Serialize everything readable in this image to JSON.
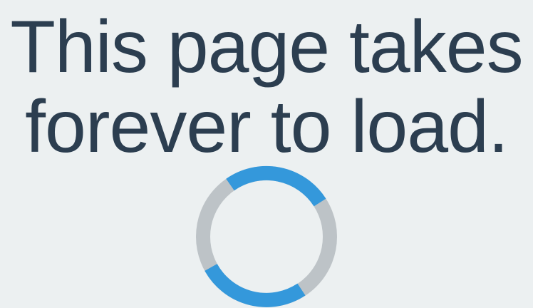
{
  "message": {
    "line1": "This page takes",
    "line2": "forever to load."
  },
  "spinner": {
    "track_color": "#bdc3c7",
    "accent_color": "#3498db",
    "icon": "loading-spinner-icon"
  },
  "colors": {
    "background": "#ecf0f1",
    "text": "#2c3e50"
  }
}
